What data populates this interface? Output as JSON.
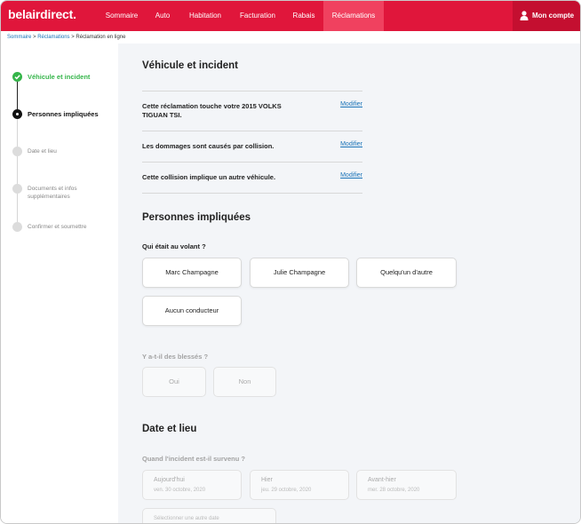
{
  "nav": {
    "logo": "belairdirect.",
    "items": [
      "Sommaire",
      "Auto",
      "Habitation",
      "Facturation",
      "Rabais",
      "Réclamations"
    ],
    "account": "Mon compte",
    "colors": {
      "brand": "#e0163b",
      "active": "#f0415f",
      "account": "#c40f30"
    }
  },
  "breadcrumb": {
    "items": [
      "Sommaire",
      "Réclamations",
      "Réclamation en ligne"
    ],
    "separator": ">"
  },
  "steps": [
    {
      "label": "Véhicule et incident",
      "state": "done"
    },
    {
      "label": "Personnes impliquées",
      "state": "current"
    },
    {
      "label": "Date et lieu",
      "state": "todo"
    },
    {
      "label": "Documents et infos supplémentaires",
      "state": "todo"
    },
    {
      "label": "Confirmer et soumettre",
      "state": "todo"
    }
  ],
  "vehicle_section": {
    "title": "Véhicule et incident",
    "rows": [
      {
        "text": "Cette réclamation touche votre 2015 VOLKS TIGUAN TSI.",
        "action": "Modifier"
      },
      {
        "text": "Les dommages sont causés par collision.",
        "action": "Modifier"
      },
      {
        "text": "Cette collision implique un autre véhicule.",
        "action": "Modifier"
      }
    ]
  },
  "persons_section": {
    "title": "Personnes impliquées",
    "driver_question": "Qui était au volant ?",
    "driver_options": [
      "Marc Champagne",
      "Julie Champagne",
      "Quelqu'un d'autre",
      "Aucun conducteur"
    ],
    "injury_question": "Y a-t-il des blessés ?",
    "injury_options": [
      "Oui",
      "Non"
    ]
  },
  "date_section": {
    "title": "Date et lieu",
    "question": "Quand l'incident est-il survenu ?",
    "options": [
      {
        "label": "Aujourd'hui",
        "date": "ven. 30 octobre, 2020"
      },
      {
        "label": "Hier",
        "date": "jeu. 29 octobre, 2020"
      },
      {
        "label": "Avant-hier",
        "date": "mer. 28 octobre, 2020"
      }
    ],
    "other_date": "Sélectionner une autre date"
  }
}
